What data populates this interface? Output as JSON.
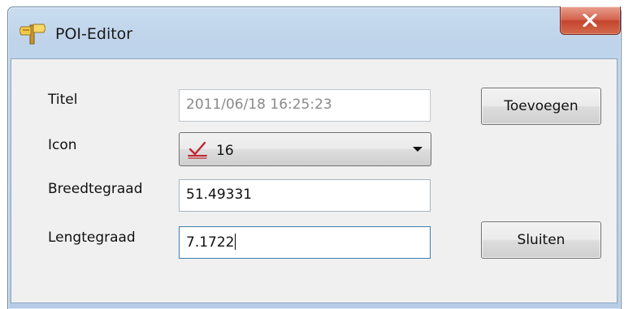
{
  "window": {
    "title": "POI-Editor",
    "title_icon": "poi-sign-icon",
    "close_icon": "close-icon"
  },
  "form": {
    "titel": {
      "label": "Titel",
      "value": "2011/06/18 16:25:23",
      "disabled": true
    },
    "icon": {
      "label": "Icon",
      "selected_value": "16",
      "selected_icon": "marker-check-icon"
    },
    "breedtegraad": {
      "label": "Breedtegraad",
      "value": "51.49331"
    },
    "lengtegraad": {
      "label": "Lengtegraad",
      "value": "7.1722"
    }
  },
  "buttons": {
    "add_label": "Toevoegen",
    "close_label": "Sluiten"
  },
  "colors": {
    "title_bar": "#bfd4ea",
    "close_button": "#c4442c",
    "client_bg": "#f0f0f0"
  }
}
